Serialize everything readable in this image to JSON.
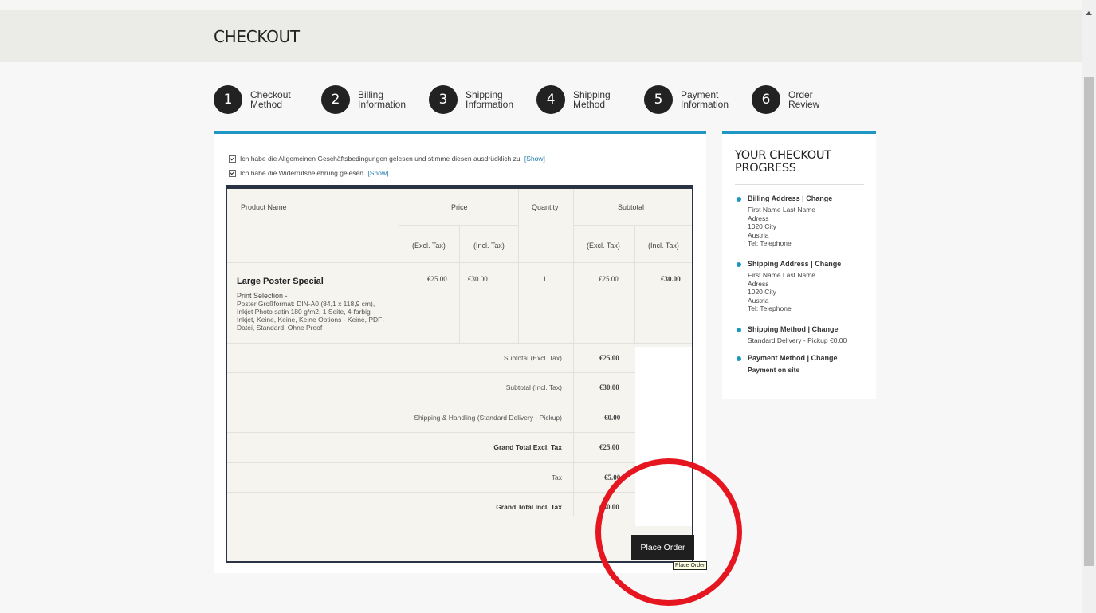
{
  "page": {
    "title": "CHECKOUT"
  },
  "steps": [
    {
      "number": "1",
      "label": "Checkout\nMethod"
    },
    {
      "number": "2",
      "label": "Billing\nInformation"
    },
    {
      "number": "3",
      "label": "Shipping\nInformation"
    },
    {
      "number": "4",
      "label": "Shipping\nMethod"
    },
    {
      "number": "5",
      "label": "Payment\nInformation"
    },
    {
      "number": "6",
      "label": "Order\nReview"
    }
  ],
  "agreements": [
    {
      "text": "Ich habe die Allgemeinen Geschäftsbedingungen gelesen und stimme diesen ausdrücklich zu.",
      "link": "[Show]",
      "checked": true
    },
    {
      "text": "Ich habe die Widerrufsbelehrung gelesen.",
      "link": "[Show]",
      "checked": true
    }
  ],
  "table": {
    "headers": {
      "product": "Product Name",
      "price": "Price",
      "quantity": "Quantity",
      "subtotal": "Subtotal",
      "excl": "(Excl. Tax)",
      "incl": "(Incl. Tax)"
    },
    "item": {
      "name": "Large Poster Special",
      "option_label": "Print Selection -",
      "option_value": "Poster Großformat: DIN-A0 (84,1 x 118,9 cm), Inkjet Photo satin 180 g/m2, 1 Seite, 4-farbig Inkjet, Keine, Keine, Keine Options - Keine, PDF-Datei, Standard, Ohne Proof",
      "price_excl": "€25.00",
      "price_incl": "€30.00",
      "qty": "1",
      "subtotal_excl": "€25.00",
      "subtotal_incl": "€30.00"
    },
    "totals": [
      {
        "label": "Subtotal (Excl. Tax)",
        "value": "€25.00",
        "bold": false
      },
      {
        "label": "Subtotal (Incl. Tax)",
        "value": "€30.00",
        "bold": false
      },
      {
        "label": "Shipping & Handling (Standard Delivery - Pickup)",
        "value": "€0.00",
        "bold": false
      },
      {
        "label": "Grand Total Excl. Tax",
        "value": "€25.00",
        "bold": true
      },
      {
        "label": "Tax",
        "value": "€5.00",
        "bold": false
      },
      {
        "label": "Grand Total Incl. Tax",
        "value": "€30.00",
        "bold": true
      }
    ]
  },
  "buttons": {
    "place_order": "Place Order",
    "tooltip": "Place Order"
  },
  "sidebar": {
    "title": "YOUR CHECKOUT PROGRESS",
    "items": [
      {
        "heading": "Billing Address  |  Change",
        "body": "First Name Last Name\nAdress\n1020 City\nAustria\nTel: Telephone"
      },
      {
        "heading": "Shipping Address  |  Change",
        "body": "First Name Last Name\nAdress\n1020 City\nAustria\nTel: Telephone"
      },
      {
        "heading": "Shipping Method  |  Change",
        "body": "Standard Delivery - Pickup €0.00"
      },
      {
        "heading": "Payment Method  |  Change",
        "body": "Payment on site"
      }
    ]
  },
  "colors": {
    "accent": "#1f97c4",
    "annotation": "#e5161f",
    "button": "#1f1f1f"
  }
}
